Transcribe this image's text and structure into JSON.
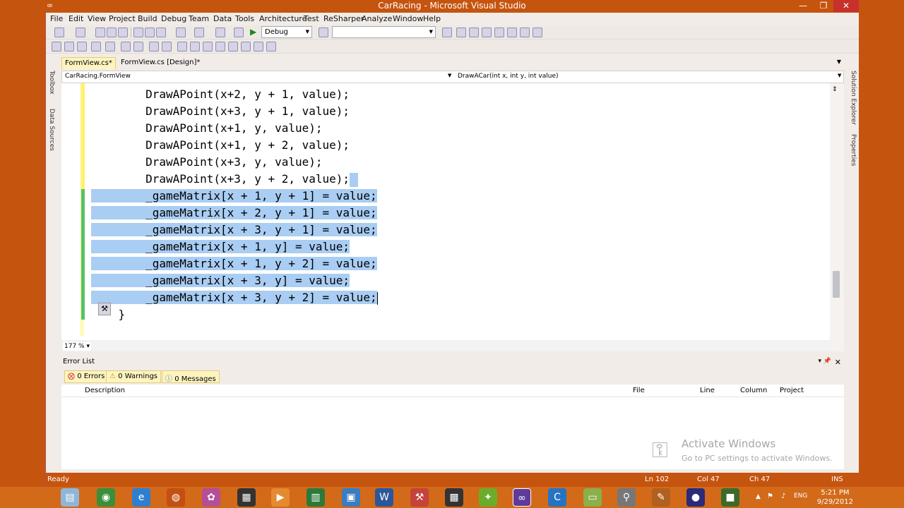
{
  "window": {
    "title": "CarRacing - Microsoft Visual Studio",
    "app_icon": "visual-studio-icon",
    "minimize": "—",
    "maximize": "❐",
    "close": "✕"
  },
  "menu": [
    "File",
    "Edit",
    "View",
    "Project",
    "Build",
    "Debug",
    "Team",
    "Data",
    "Tools",
    "Architecture",
    "Test",
    "ReSharper",
    "Analyze",
    "Window",
    "Help"
  ],
  "toolbar": {
    "configuration": "Debug",
    "search_value": ""
  },
  "side_tabs": {
    "left": [
      "Toolbox",
      "Data Sources"
    ],
    "right": [
      "Solution Explorer",
      "Properties"
    ]
  },
  "doc_tabs": [
    {
      "label": "FormView.cs*",
      "active": true
    },
    {
      "label": "FormView.cs [Design]*",
      "active": false
    }
  ],
  "nav": {
    "type": "CarRacing.FormView",
    "member": "DrawACar(int x, int y, int value)"
  },
  "editor": {
    "zoom": "177 %",
    "lines": [
      {
        "text": "        DrawAPoint(x+2, y + 1, value);",
        "selected": false
      },
      {
        "text": "        DrawAPoint(x+3, y + 1, value);",
        "selected": false
      },
      {
        "text": "        DrawAPoint(x+1, y, value);",
        "selected": false
      },
      {
        "text": "        DrawAPoint(x+1, y + 2, value);",
        "selected": false
      },
      {
        "text": "        DrawAPoint(x+3, y, value);",
        "selected": false
      },
      {
        "text": "        DrawAPoint(x+3, y + 2, value);",
        "selected": false
      },
      {
        "text": "        _gameMatrix[x + 1, y + 1] = value;",
        "selected": true
      },
      {
        "text": "        _gameMatrix[x + 2, y + 1] = value;",
        "selected": true
      },
      {
        "text": "        _gameMatrix[x + 3, y + 1] = value;",
        "selected": true
      },
      {
        "text": "        _gameMatrix[x + 1, y] = value;",
        "selected": true
      },
      {
        "text": "        _gameMatrix[x + 1, y + 2] = value;",
        "selected": true
      },
      {
        "text": "        _gameMatrix[x + 3, y] = value;",
        "selected": true
      },
      {
        "text": "        _gameMatrix[x + 3, y + 2] = value;",
        "selected": true
      },
      {
        "text": "    }",
        "selected": false
      }
    ]
  },
  "error_list": {
    "title": "Error List",
    "filters": {
      "errors": "0 Errors",
      "warnings": "0 Warnings",
      "messages": "0 Messages"
    },
    "columns": [
      "Description",
      "File",
      "Line",
      "Column",
      "Project"
    ],
    "watermark_title": "Activate Windows",
    "watermark_sub": "Go to PC settings to activate Windows."
  },
  "status": {
    "state": "Ready",
    "ln": "Ln 102",
    "col": "Col 47",
    "ch": "Ch 47",
    "mode": "INS"
  },
  "taskbar": {
    "apps": [
      "file-explorer-icon",
      "chrome-icon",
      "internet-explorer-icon",
      "firefox-icon",
      "paint-icon",
      "calendar-icon",
      "media-player-icon",
      "excel-icon",
      "folder-icon",
      "word-icon",
      "tool-icon",
      "calculator-icon",
      "bird-icon",
      "visual-studio-icon",
      "ccleaner-icon",
      "notepad-icon",
      "mic-icon",
      "pen-icon",
      "eclipse-icon",
      "camera-icon"
    ],
    "lang": "ENG",
    "time": "5:21 PM",
    "date": "9/29/2012"
  }
}
